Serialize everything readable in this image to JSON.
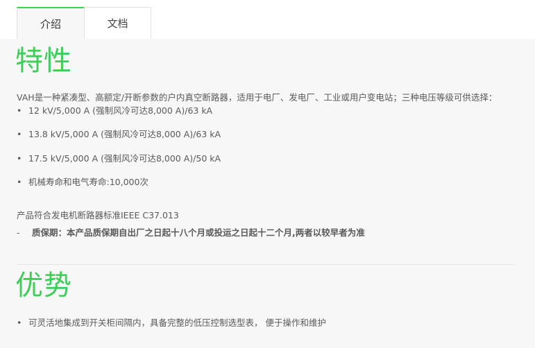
{
  "tabs": [
    {
      "label": "介绍",
      "active": true
    },
    {
      "label": "文档",
      "active": false
    }
  ],
  "features": {
    "heading": "特性",
    "intro": "VAH是一种紧凑型、高额定/开断参数的户内真空断路器，适用于电厂、发电厂、工业或用户变电站；三种电压等级可供选择：",
    "bullets": [
      "12 kV/5,000 A (强制风冷可达8,000 A)/63 kA",
      "13.8 kV/5,000 A (强制风冷可达8,000 A)/63 kA",
      "17.5 kV/5,000 A (强制风冷可达8,000 A)/50 kA",
      "机械寿命和电气寿命:10,000次"
    ],
    "standard": "产品符合发电机断路器标准IEEE C37.013",
    "warranty_dash": "-",
    "warranty": "质保期：本产品质保期自出厂之日起十八个月或投运之日起十二个月,两者以较早者为准"
  },
  "advantages": {
    "heading": "优势",
    "bullets": [
      "可灵活地集成到开关柜间隔内，具备完整的低压控制选型表， 便于操作和维护"
    ]
  },
  "colors": {
    "accent": "#3dcd58",
    "text": "#595959",
    "background": "#f7f7f7"
  }
}
